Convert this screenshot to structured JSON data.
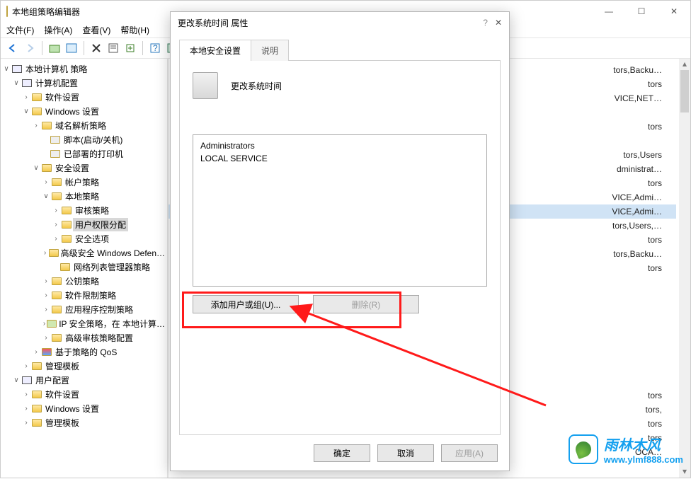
{
  "main_title": "本地组策略编辑器",
  "menus": {
    "file": "文件(F)",
    "action": "操作(A)",
    "view": "查看(V)",
    "help": "帮助(H)"
  },
  "tree": {
    "root": "本地计算机 策略",
    "computer_config": "计算机配置",
    "software_settings": "软件设置",
    "windows_settings": "Windows 设置",
    "dns_policy": "域名解析策略",
    "scripts": "脚本(启动/关机)",
    "printers": "已部署的打印机",
    "security_settings": "安全设置",
    "account_policy": "帐户策略",
    "local_policy": "本地策略",
    "audit_policy": "审核策略",
    "user_rights": "用户权限分配",
    "security_options": "安全选项",
    "wdefender": "高级安全 Windows Defen…",
    "netlist": "网络列表管理器策略",
    "pubkey": "公钥策略",
    "srp": "软件限制策略",
    "appctrl": "应用程序控制策略",
    "ipsec": "IP 安全策略，在 本地计算…",
    "advaudit": "高级审核策略配置",
    "qos": "基于策略的 QoS",
    "admin_templates": "管理模板",
    "user_config": "用户配置",
    "user_software": "软件设置",
    "user_windows": "Windows 设置",
    "user_admin": "管理模板"
  },
  "right_items": [
    "tors,Backu…",
    "tors",
    "VICE,NET…",
    "",
    "tors",
    "",
    "tors,Users",
    "dministrat…",
    "tors",
    "VICE,Admi…",
    "VICE,Admi…",
    "tors,Users,…",
    "tors",
    "tors,Backu…",
    "tors",
    "",
    "",
    "",
    "",
    "",
    "",
    "",
    "",
    "tors",
    "tors,",
    "tors",
    "tors",
    "OCA…"
  ],
  "right_selected_index": 10,
  "dialog": {
    "title": "更改系统时间 属性",
    "tabs": {
      "security": "本地安全设置",
      "explain": "说明"
    },
    "policy_name": "更改系统时间",
    "members": [
      "Administrators",
      "LOCAL SERVICE"
    ],
    "add_btn": "添加用户或组(U)...",
    "remove_btn": "删除(R)",
    "ok": "确定",
    "cancel": "取消",
    "apply": "应用(A)"
  },
  "watermark": {
    "top": "雨林木风",
    "bottom": "www.ylmf888.com"
  }
}
